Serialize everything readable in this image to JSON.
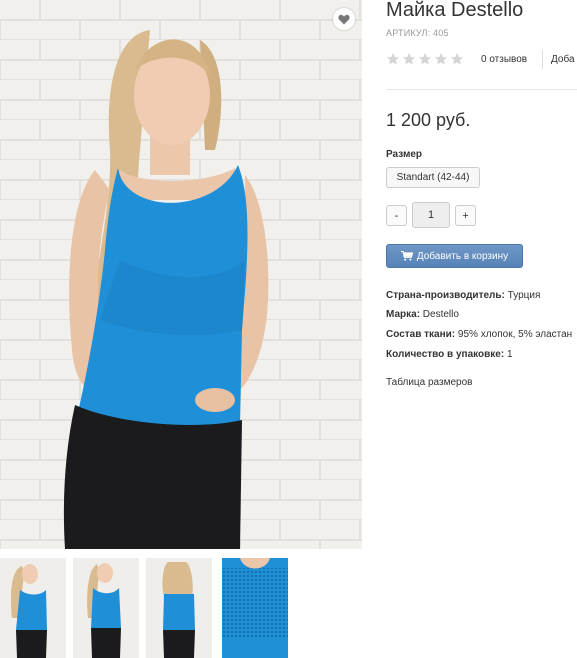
{
  "product": {
    "title": "Майка Destello",
    "sku": "АРТИКУЛ: 405",
    "rating_stars": 5,
    "rating_value": 0,
    "reviews_label": "0 отзывов",
    "add_review_label": "Доба",
    "price": "1 200 руб."
  },
  "size": {
    "label": "Размер",
    "selected": "Standart (42-44)"
  },
  "quantity": {
    "minus": "-",
    "value": "1",
    "plus": "+"
  },
  "cart": {
    "button_label": "Добавить в корзину",
    "icon": "cart-icon"
  },
  "attributes": [
    {
      "key": "Страна-производитель:",
      "value": " Турция"
    },
    {
      "key": "Марка:",
      "value": " Destello"
    },
    {
      "key": "Состав ткани:",
      "value": " 95% хлопок, 5% эластан"
    },
    {
      "key": "Количество в упаковке:",
      "value": " 1"
    }
  ],
  "size_table_link": "Таблица размеров",
  "icons": {
    "favorite": "heart-icon",
    "star": "star-icon"
  },
  "colors": {
    "accent_button": "#6089bd",
    "top_color": "#1b8fd6",
    "star_empty": "#d6d6d6"
  },
  "thumbnails": [
    "thumb-front",
    "thumb-front-2",
    "thumb-back",
    "thumb-detail"
  ]
}
